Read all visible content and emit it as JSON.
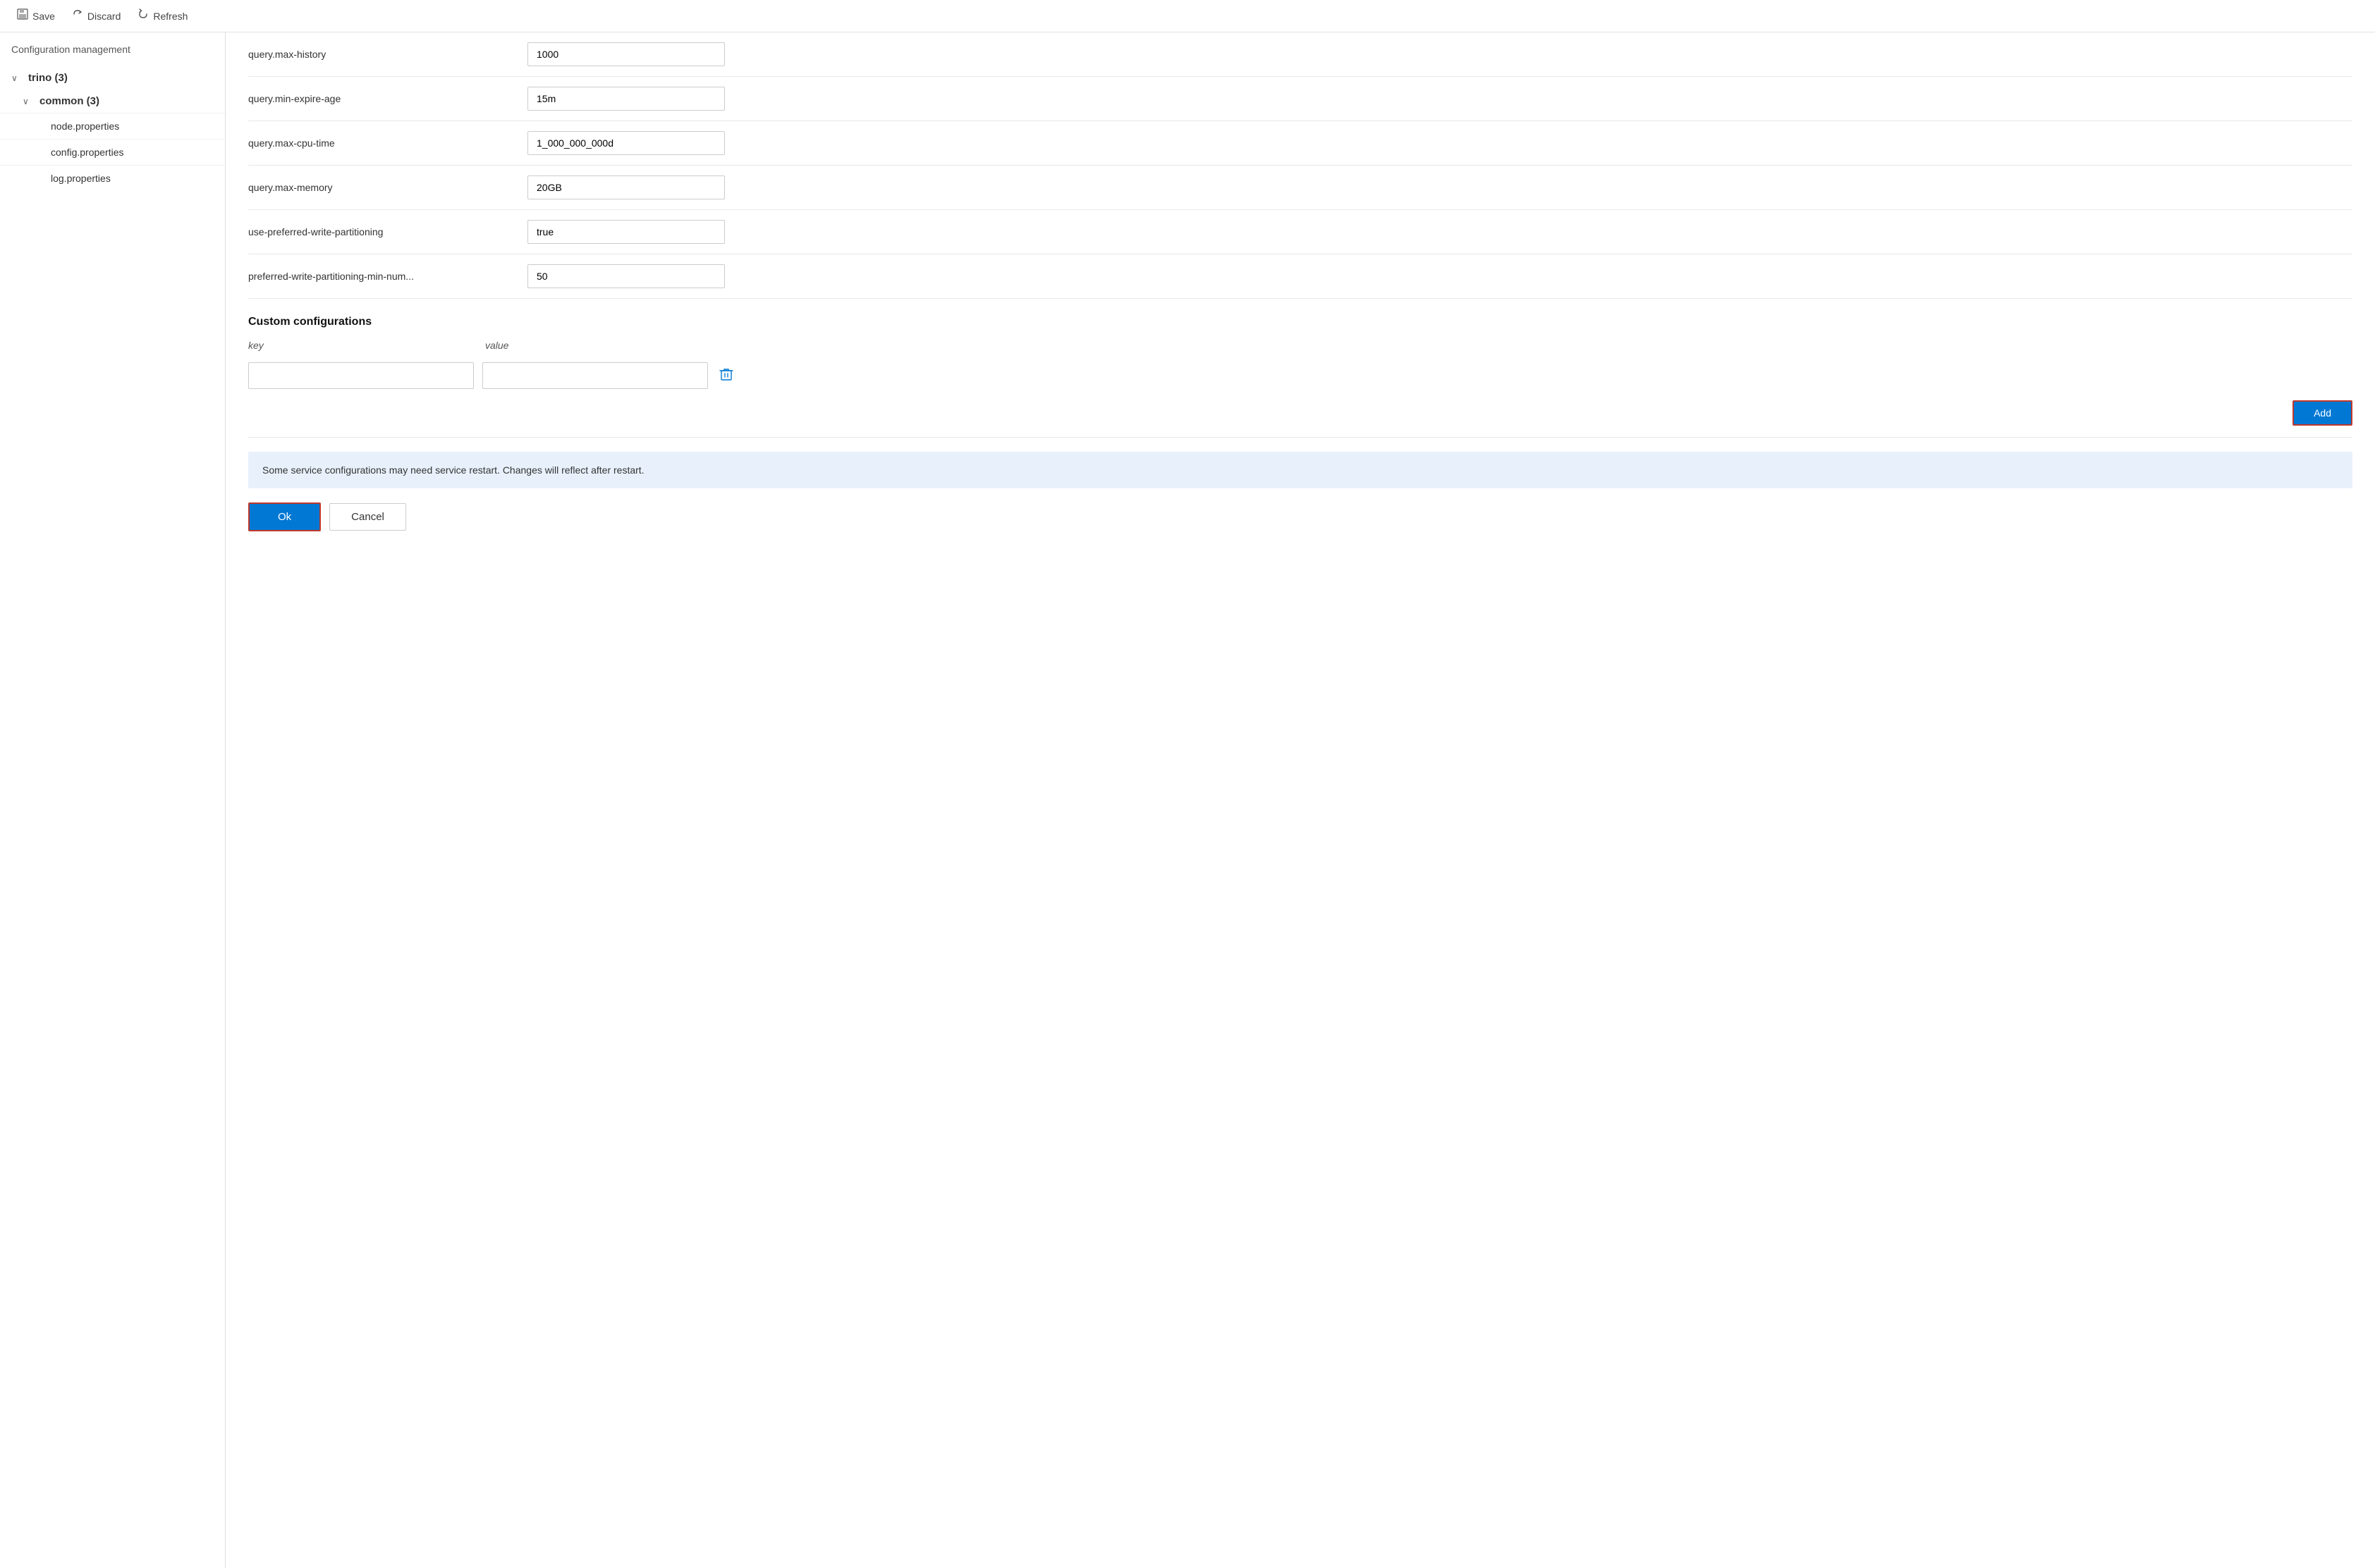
{
  "toolbar": {
    "save_label": "Save",
    "discard_label": "Discard",
    "refresh_label": "Refresh"
  },
  "sidebar": {
    "title": "Configuration management",
    "tree": {
      "root_label": "trino (3)",
      "child_label": "common (3)",
      "files": [
        "node.properties",
        "config.properties",
        "log.properties"
      ]
    }
  },
  "config_rows": [
    {
      "key": "query.max-history",
      "value": "1000"
    },
    {
      "key": "query.min-expire-age",
      "value": "15m"
    },
    {
      "key": "query.max-cpu-time",
      "value": "1_000_000_000d"
    },
    {
      "key": "query.max-memory",
      "value": "20GB"
    },
    {
      "key": "use-preferred-write-partitioning",
      "value": "true"
    },
    {
      "key": "preferred-write-partitioning-min-num...",
      "value": "50"
    }
  ],
  "custom_section": {
    "title": "Custom configurations",
    "key_label": "key",
    "value_label": "value",
    "add_button_label": "Add"
  },
  "info_banner": {
    "text": "Some service configurations may need service restart. Changes will reflect after restart."
  },
  "footer": {
    "ok_label": "Ok",
    "cancel_label": "Cancel"
  }
}
